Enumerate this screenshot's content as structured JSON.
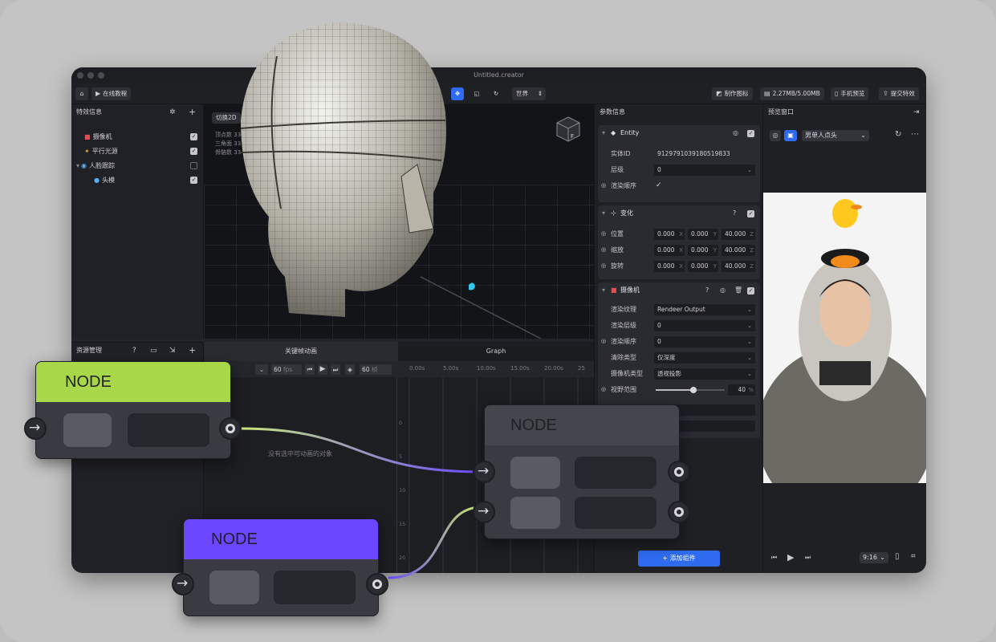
{
  "window": {
    "title": "Untitled.creator"
  },
  "toolbar": {
    "tutorial": "在线教程",
    "space_select": "世界",
    "make_icon": "制作图标",
    "size": "2.27MB/5.00MB",
    "phone_preview": "手机预览",
    "submit": "提交特效"
  },
  "effects_panel": {
    "title": "特效信息",
    "items": [
      {
        "label": "摄像机",
        "checked": true
      },
      {
        "label": "平行光源",
        "checked": true
      },
      {
        "label": "人脸跟踪",
        "checked": false
      },
      {
        "label": "头模",
        "checked": true
      }
    ]
  },
  "assets_panel": {
    "title": "资源管理"
  },
  "viewport": {
    "switch_2d": "切换2D",
    "stats": [
      "顶点数",
      "三角面",
      "骨骼数"
    ],
    "stat_values": [
      "33",
      "33",
      "33"
    ],
    "gizmo_label": "F"
  },
  "bottom_tabs": [
    "关键帧动画",
    "Graph"
  ],
  "timeline": {
    "fps": "60",
    "fps_unit": "fps",
    "frame": "60",
    "frame_unit": "帧",
    "ticks": [
      "0.00s",
      "5.00s",
      "10.00s",
      "15.00s",
      "20.00s",
      "25"
    ],
    "side_ticks": [
      "0",
      "5",
      "10",
      "15",
      "20"
    ],
    "empty_msg": "没有选中可动画的对象"
  },
  "params": {
    "title": "参数信息",
    "entity": {
      "title": "Entity",
      "id_label": "实体ID",
      "id_value": "9129791039180519833",
      "layer_label": "层级",
      "layer_value": "0",
      "order_label": "渲染顺序"
    },
    "transform": {
      "title": "变化",
      "rows": [
        {
          "label": "位置",
          "x": "0.000",
          "y": "0.000",
          "z": "40.000"
        },
        {
          "label": "缩放",
          "x": "0.000",
          "y": "0.000",
          "z": "40.000"
        },
        {
          "label": "旋转",
          "x": "0.000",
          "y": "0.000",
          "z": "40.000"
        }
      ],
      "axes": [
        "X",
        "Y",
        "Z"
      ]
    },
    "camera": {
      "title": "摄像机",
      "rows": [
        {
          "label": "渲染纹理",
          "value": "Rendeer Output"
        },
        {
          "label": "渲染层级",
          "value": "0"
        },
        {
          "label": "渲染顺序",
          "value": "0"
        },
        {
          "label": "清除类型",
          "value": "仅深度"
        },
        {
          "label": "摄像机类型",
          "value": "透视投影"
        }
      ],
      "fov_label": "视野范围",
      "fov_value": "40",
      "fov_unit": "%",
      "fov_level": 0.55
    },
    "add_component": "添加组件"
  },
  "preview": {
    "title": "预览窗口",
    "preset": "男单人点头",
    "ratio": "9:16"
  },
  "nodes": [
    {
      "title": "NODE",
      "accent": "#a8d84a"
    },
    {
      "title": "NODE",
      "accent": "#6a46ff"
    },
    {
      "title": "NODE",
      "accent": "#3a3b42"
    }
  ],
  "colors": {
    "accent_blue": "#2e6bf0",
    "node_green": "#a8d84a",
    "node_purple": "#6a46ff"
  }
}
